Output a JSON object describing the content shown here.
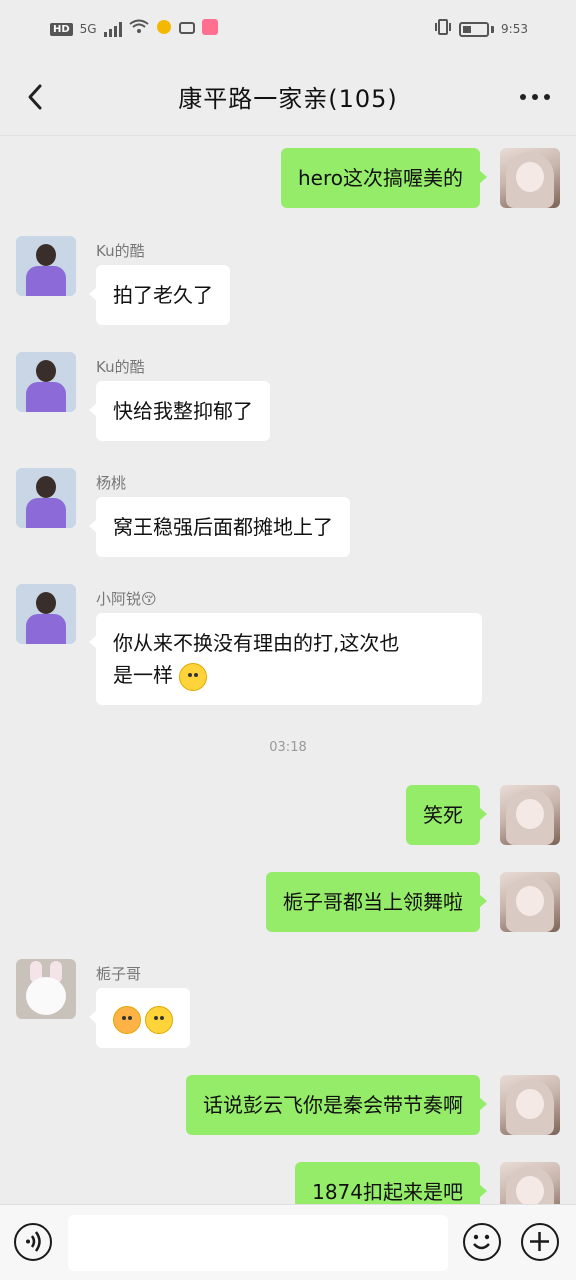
{
  "status_bar": {
    "hd": "HD",
    "net": "5G",
    "time": "9:53"
  },
  "header": {
    "title": "康平路一家亲(105)"
  },
  "messages": [
    {
      "side": "out",
      "text": "hero这次搞喔美的"
    },
    {
      "side": "in",
      "sender": "Ku的酷",
      "text": "拍了老久了"
    },
    {
      "side": "in",
      "sender": "Ku的酷",
      "text": "快给我整抑郁了"
    },
    {
      "side": "in",
      "sender": "杨桃",
      "text": "窝王稳强后面都摊地上了"
    },
    {
      "side": "in",
      "sender": "小阿锐😚",
      "text_line1": "你从来不换没有理由的打,这次也",
      "text_line2": "是一样"
    },
    {
      "timestamp": "03:18"
    },
    {
      "side": "out",
      "text": "笑死"
    },
    {
      "side": "out",
      "text": "栀子哥都当上领舞啦"
    },
    {
      "side": "in",
      "sender": "栀子哥",
      "text": ""
    },
    {
      "side": "out",
      "text": "话说彭云飞你是秦会带节奏啊"
    },
    {
      "side": "out",
      "text": "1874扣起来是吧"
    }
  ]
}
